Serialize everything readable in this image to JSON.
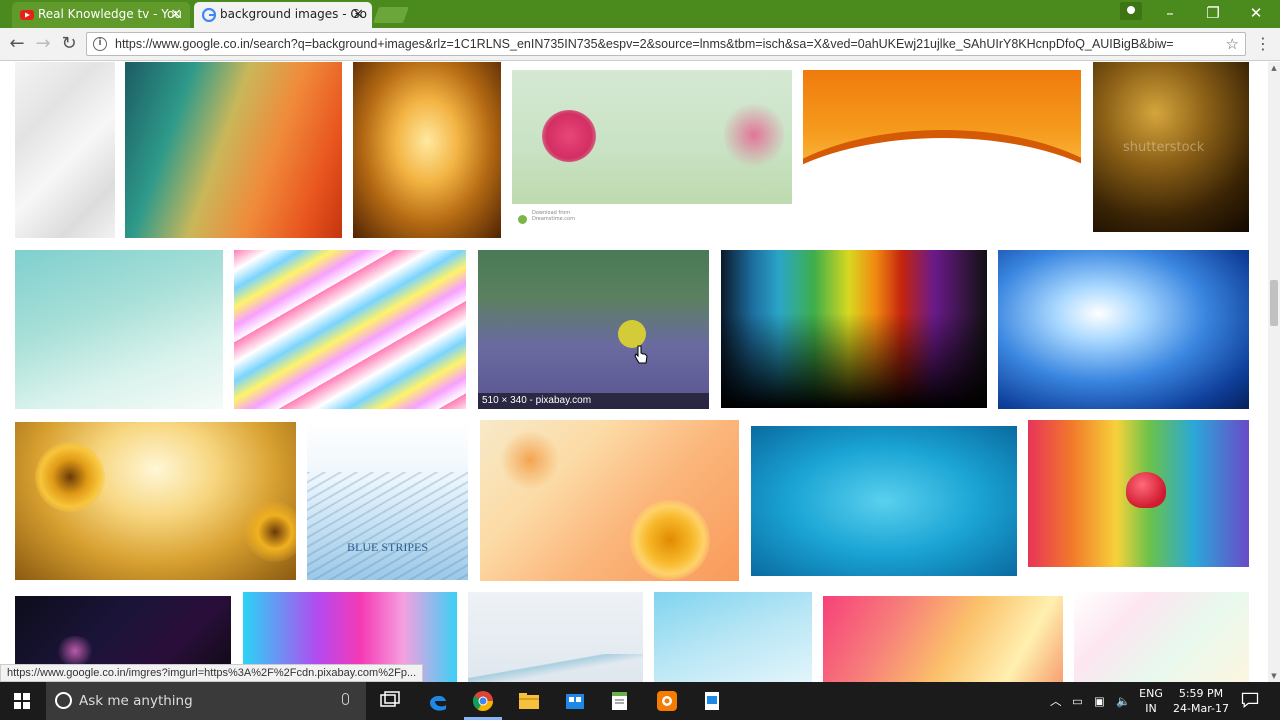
{
  "browser": {
    "tabs": [
      {
        "title": "Real Knowledge tv - You",
        "close": "×",
        "active": false
      },
      {
        "title": "background images - Go",
        "close": "×",
        "active": true
      }
    ],
    "window_controls": {
      "minimize": "–",
      "restore": "❐",
      "close": "✕"
    },
    "nav": {
      "back": "←",
      "forward": "→",
      "reload": "↻"
    },
    "address": "https://www.google.co.in/search?q=background+images&rlz=1C1RLNS_enIN735IN735&espv=2&source=lnms&tbm=isch&sa=X&ved=0ahUKEwj21ujlke_SAhUIrY8KHcnpDfoQ_AUIBigB&biw=",
    "info_icon": "i",
    "star_icon": "☆",
    "menu_icon": "⋮"
  },
  "results": {
    "hover_caption": "510 × 340 - pixabay.com",
    "overlay_texts": {
      "shutterstock": "shutterstock",
      "blue_stripes": "BLUE STRIPES",
      "dreamstime": "Download from Dreamstime.com"
    }
  },
  "status_url": "https://www.google.co.in/imgres?imgurl=https%3A%2F%2Fcdn.pixabay.com%2Fp...",
  "taskbar": {
    "search_placeholder": "Ask me anything",
    "language_top": "ENG",
    "language_bottom": "IN",
    "time": "5:59 PM",
    "date": "24-Mar-17"
  },
  "colors": {
    "chrome_frame": "#4b8a1c",
    "taskbar": "#1b1b1b"
  }
}
